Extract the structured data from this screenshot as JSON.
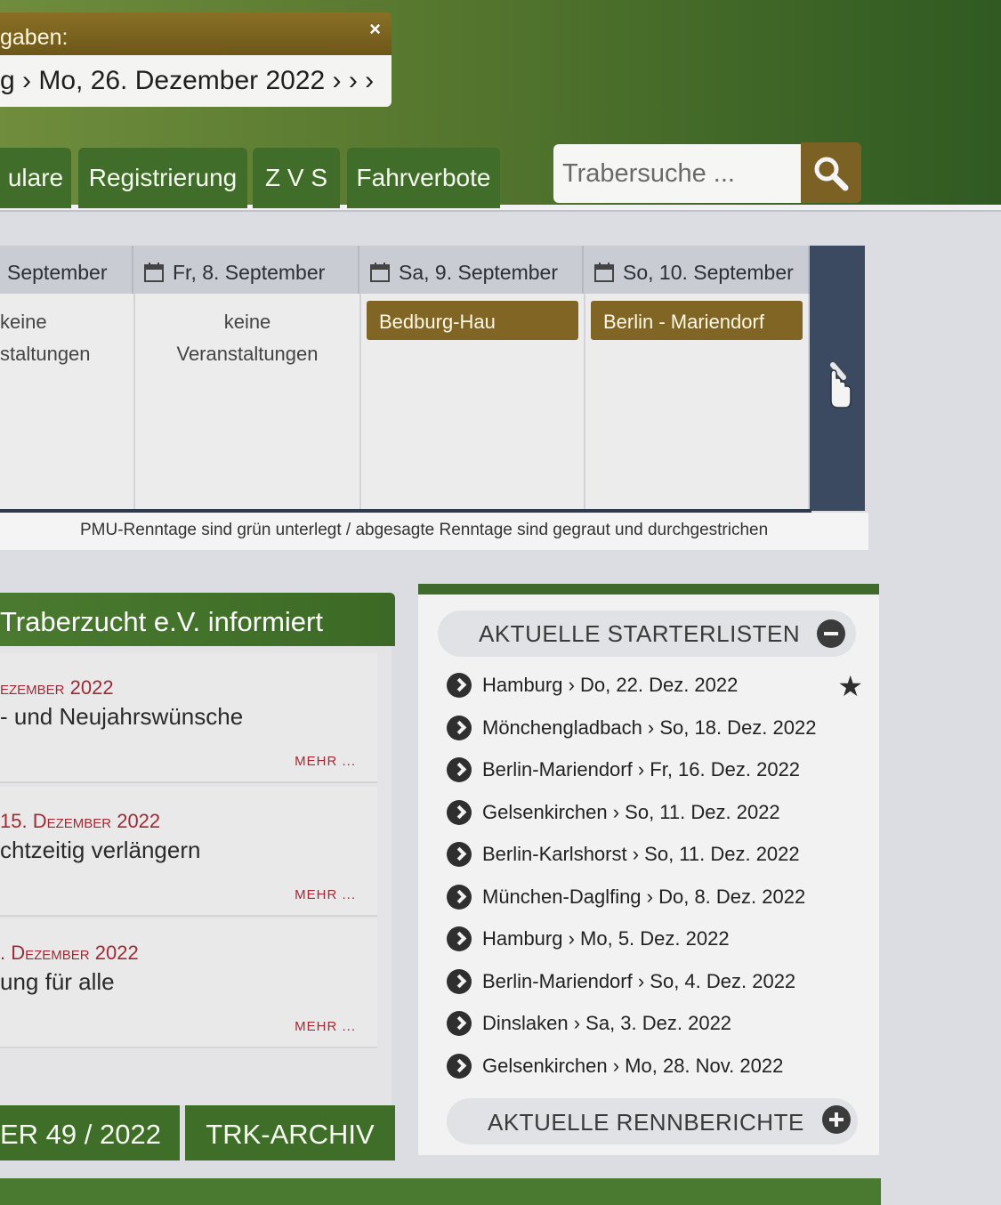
{
  "notice": {
    "title": "gaben:",
    "close": "×",
    "text": "g › Mo, 26. Dezember 2022 › › ›"
  },
  "nav": {
    "items": [
      "ulare",
      "Registrierung",
      "Z V S",
      "Fahrverbote"
    ]
  },
  "search": {
    "placeholder": "Trabersuche ..."
  },
  "calendar": {
    "days": [
      "September",
      "Fr, 8. September",
      "Sa, 9. September",
      "So, 10. September"
    ],
    "col0_line1": "keine",
    "col0_line2": "staltungen",
    "col1_line1": "keine",
    "col1_line2": "Veranstaltungen",
    "events": [
      "Bedburg-Hau",
      "Berlin - Mariendorf"
    ],
    "note": "PMU-Renntage sind grün unterlegt / abgesagte Renntage sind gegraut und durchgestrichen"
  },
  "news": {
    "title": "Traberzucht e.V. informiert",
    "items": [
      {
        "date": "ezember 2022",
        "text": "- und Neujahrswünsche",
        "more": "MEHR ..."
      },
      {
        "date": "15. Dezember 2022",
        "text": "chtzeitig verlängern",
        "more": "MEHR ..."
      },
      {
        "date": ". Dezember 2022",
        "text": "ung für alle",
        "more": "MEHR ..."
      }
    ],
    "footer_left": "ER 49 / 2022",
    "footer_right": "TRK-ARCHIV"
  },
  "starter": {
    "header": "AKTUELLE STARTERLISTEN",
    "items": [
      "Hamburg › Do, 22. Dez. 2022",
      "Mönchengladbach › So, 18. Dez. 2022",
      "Berlin-Mariendorf › Fr, 16. Dez. 2022",
      "Gelsenkirchen › So, 11. Dez. 2022",
      "Berlin-Karlshorst › So, 11. Dez. 2022",
      "München-Daglfing › Do, 8. Dez. 2022",
      "Hamburg › Mo, 5. Dez. 2022",
      "Berlin-Mariendorf › So, 4. Dez. 2022",
      "Dinslaken › Sa, 3. Dez. 2022",
      "Gelsenkirchen › Mo, 28. Nov. 2022"
    ],
    "berichte_header": "AKTUELLE RENNBERICHTE"
  },
  "colors": {
    "nav_green": "#416d2a",
    "gold": "#806524",
    "news_date_red": "#9e2a36",
    "calendar_header": "#c9ccd3",
    "calendar_nav": "#3b4a60"
  },
  "icons": {
    "search": "magnifier-icon",
    "calendar": "calendar-icon",
    "next": "hand-pointer-icon",
    "list_bullet": "circle-arrow-right-icon",
    "favorite": "star-icon",
    "collapse": "minus-circle-icon",
    "expand": "plus-circle-icon"
  }
}
